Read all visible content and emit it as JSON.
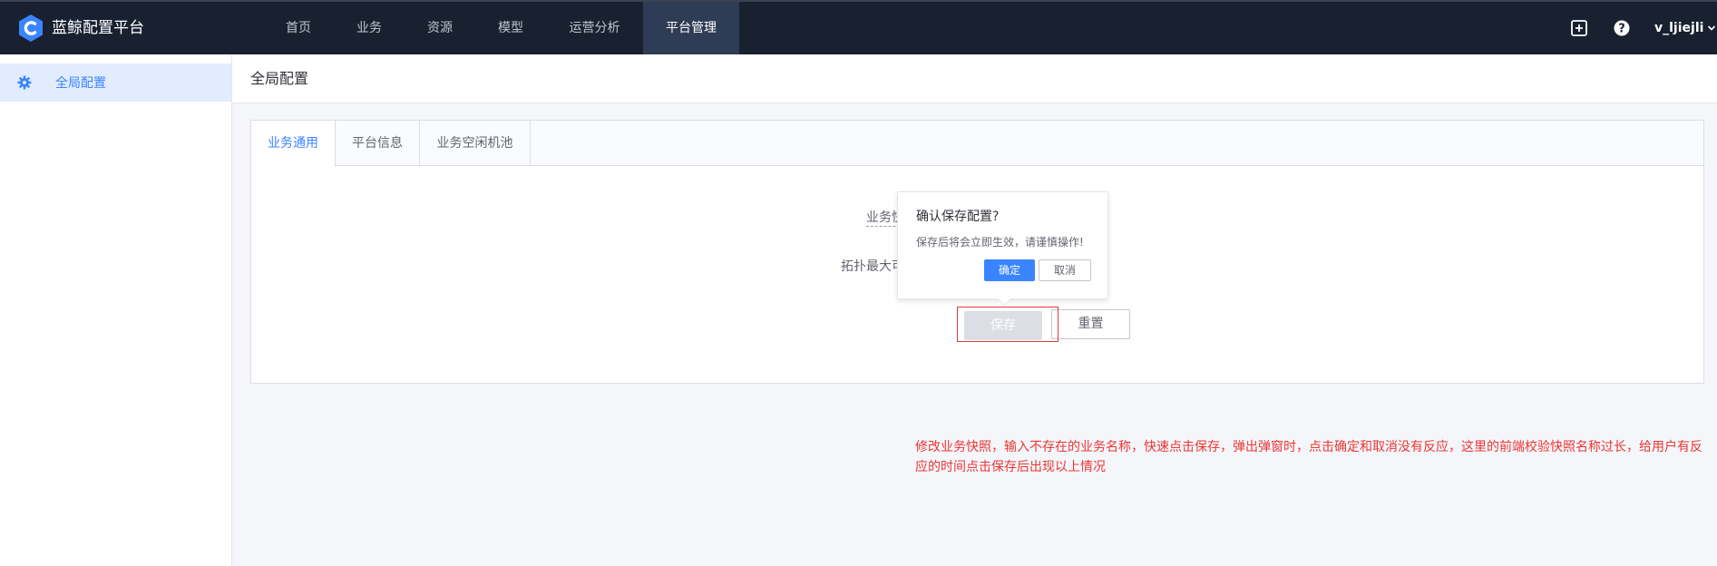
{
  "brand": {
    "title": "蓝鲸配置平台",
    "logo_icon": "bk-cmdb-logo-icon",
    "logo_color": "#3a84ff"
  },
  "nav": {
    "items": [
      {
        "label": "首页"
      },
      {
        "label": "业务"
      },
      {
        "label": "资源"
      },
      {
        "label": "模型"
      },
      {
        "label": "运营分析"
      },
      {
        "label": "平台管理"
      }
    ],
    "active_label": "平台管理"
  },
  "top_right": {
    "icons": [
      "switch-window-icon",
      "help-icon"
    ],
    "username": "v_ljiejli"
  },
  "sidebar": {
    "items": [
      {
        "label": "全局配置",
        "icon": "gear-icon"
      }
    ]
  },
  "header": {
    "title": "全局配置"
  },
  "tabs": [
    {
      "label": "业务通用"
    },
    {
      "label": "平台信息"
    },
    {
      "label": "业务空闲机池"
    }
  ],
  "form": {
    "snapshot_label_partial": "业务快",
    "topology_label_partial": "拓扑最大可",
    "save_label": "保存",
    "reset_label": "重置"
  },
  "popconfirm": {
    "title": "确认保存配置?",
    "content": "保存后将会立即生效，请谨慎操作!",
    "ok_label": "确定",
    "cancel_label": "取消"
  },
  "annotation": {
    "text": "修改业务快照，输入不存在的业务名称，快速点击保存，弹出弹窗时，点击确定和取消没有反应，这里的前端校验快照名称过长，给用户有反应的时间点击保存后出现以上情况"
  },
  "colors": {
    "topbar_bg": "#192131",
    "accent": "#3a84ff",
    "annotation_red": "#ea3636"
  }
}
